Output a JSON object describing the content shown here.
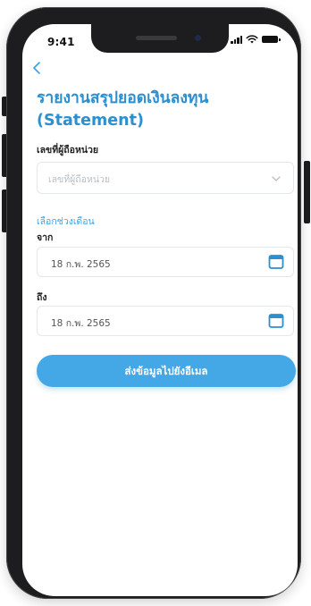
{
  "status_bar": {
    "time": "9:41"
  },
  "page": {
    "title_line1": "รายงานสรุปยอดเงินลงทุน",
    "title_line2": "(Statement)"
  },
  "unitholder": {
    "label": "เลขที่ผู้ถือหน่วย",
    "placeholder": "เลขที่ผู้ถือหน่วย"
  },
  "period": {
    "section_label": "เลือกช่วงเดือน",
    "from_label": "จาก",
    "from_value": "18 ก.พ. 2565",
    "to_label": "ถึง",
    "to_value": "18 ก.พ. 2565"
  },
  "actions": {
    "submit_label": "ส่งข้อมูลไปยังอีเมล"
  },
  "icons": {
    "back": "chevron-left-icon",
    "dropdown": "chevron-down-icon",
    "calendar": "calendar-icon"
  },
  "colors": {
    "accent": "#2b8fd0",
    "button": "#44a8e6"
  }
}
